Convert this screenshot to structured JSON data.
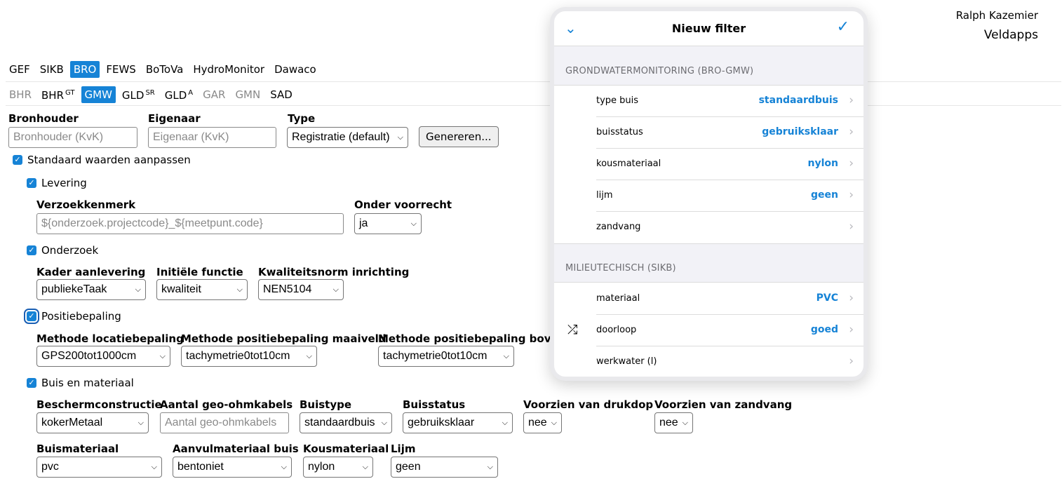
{
  "header": {
    "user": "Ralph Kazemier",
    "app": "Veldapps"
  },
  "main_tabs": [
    {
      "label": "GEF",
      "sup": ""
    },
    {
      "label": "SIKB",
      "sup": ""
    },
    {
      "label": "BRO",
      "sup": ""
    },
    {
      "label": "FEWS",
      "sup": ""
    },
    {
      "label": "BoToVa",
      "sup": ""
    },
    {
      "label": "HydroMonitor",
      "sup": ""
    },
    {
      "label": "Dawaco",
      "sup": ""
    }
  ],
  "sub_tabs": [
    {
      "label": "BHR",
      "sup": ""
    },
    {
      "label": "BHR",
      "sup": "GT"
    },
    {
      "label": "GMW",
      "sup": ""
    },
    {
      "label": "GLD",
      "sup": "SR"
    },
    {
      "label": "GLD",
      "sup": "A"
    },
    {
      "label": "GAR",
      "sup": ""
    },
    {
      "label": "GMN",
      "sup": ""
    },
    {
      "label": "SAD",
      "sup": ""
    }
  ],
  "form": {
    "bronhouder_label": "Bronhouder",
    "bronhouder_placeholder": "Bronhouder (KvK)",
    "eigenaar_label": "Eigenaar",
    "eigenaar_placeholder": "Eigenaar (KvK)",
    "type_label": "Type",
    "type_value": "Registratie (default)",
    "generate_label": "Genereren...",
    "std_label": "Standaard waarden aanpassen",
    "levering_label": "Levering",
    "verzoek_label": "Verzoekkenmerk",
    "verzoek_placeholder": "${onderzoek.projectcode}_${meetpunt.code}",
    "voorrecht_label": "Onder voorrecht",
    "voorrecht_value": "ja",
    "onderzoek_label": "Onderzoek",
    "kader_label": "Kader aanlevering",
    "kader_value": "publiekeTaak",
    "functie_label": "Initiële functie",
    "functie_value": "kwaliteit",
    "norm_label": "Kwaliteitsnorm inrichting",
    "norm_value": "NEN5104",
    "positie_label": "Positiebepaling",
    "locatie_label": "Methode locatiebepaling",
    "locatie_value": "GPS200tot1000cm",
    "maaiveld_label": "Methode positiebepaling maaiveld",
    "maaiveld_value": "tachymetrie0tot10cm",
    "boven_label": "Methode positiebepaling bovenkant",
    "boven_value": "tachymetrie0tot10cm",
    "buis_label": "Buis en materiaal",
    "bescherm_label": "Beschermconstructie",
    "bescherm_value": "kokerMetaal",
    "ohm_label": "Aantal geo-ohmkabels",
    "ohm_placeholder": "Aantal geo-ohmkabels",
    "buistype_label": "Buistype",
    "buistype_value": "standaardbuis",
    "buisstatus_label": "Buisstatus",
    "buisstatus_value": "gebruiksklaar",
    "drukdop_label": "Voorzien van drukdop",
    "drukdop_value": "nee",
    "zandvang_label": "Voorzien van zandvang",
    "zandvang_value": "nee",
    "buismat_label": "Buismateriaal",
    "buismat_value": "pvc",
    "aanvul_label": "Aanvulmateriaal buis",
    "aanvul_value": "bentoniet",
    "kous_label": "Kousmateriaal",
    "kous_value": "nylon",
    "lijm_label": "Lijm",
    "lijm_value": "geen"
  },
  "popover": {
    "title": "Nieuw filter",
    "group1": "GRONDWATERMONITORING (BRO-GMW)",
    "group1_rows": [
      {
        "name": "type buis",
        "value": "standaardbuis"
      },
      {
        "name": "buisstatus",
        "value": "gebruiksklaar"
      },
      {
        "name": "kousmateriaal",
        "value": "nylon"
      },
      {
        "name": "lijm",
        "value": "geen"
      },
      {
        "name": "zandvang",
        "value": ""
      }
    ],
    "group2": "MILIEUTECHISCH (SIKB)",
    "group2_rows": [
      {
        "name": "materiaal",
        "value": "PVC"
      },
      {
        "name": "doorloop",
        "value": "goed"
      },
      {
        "name": "werkwater (l)",
        "value": ""
      }
    ]
  },
  "colors": {
    "accent": "#1683d6"
  }
}
